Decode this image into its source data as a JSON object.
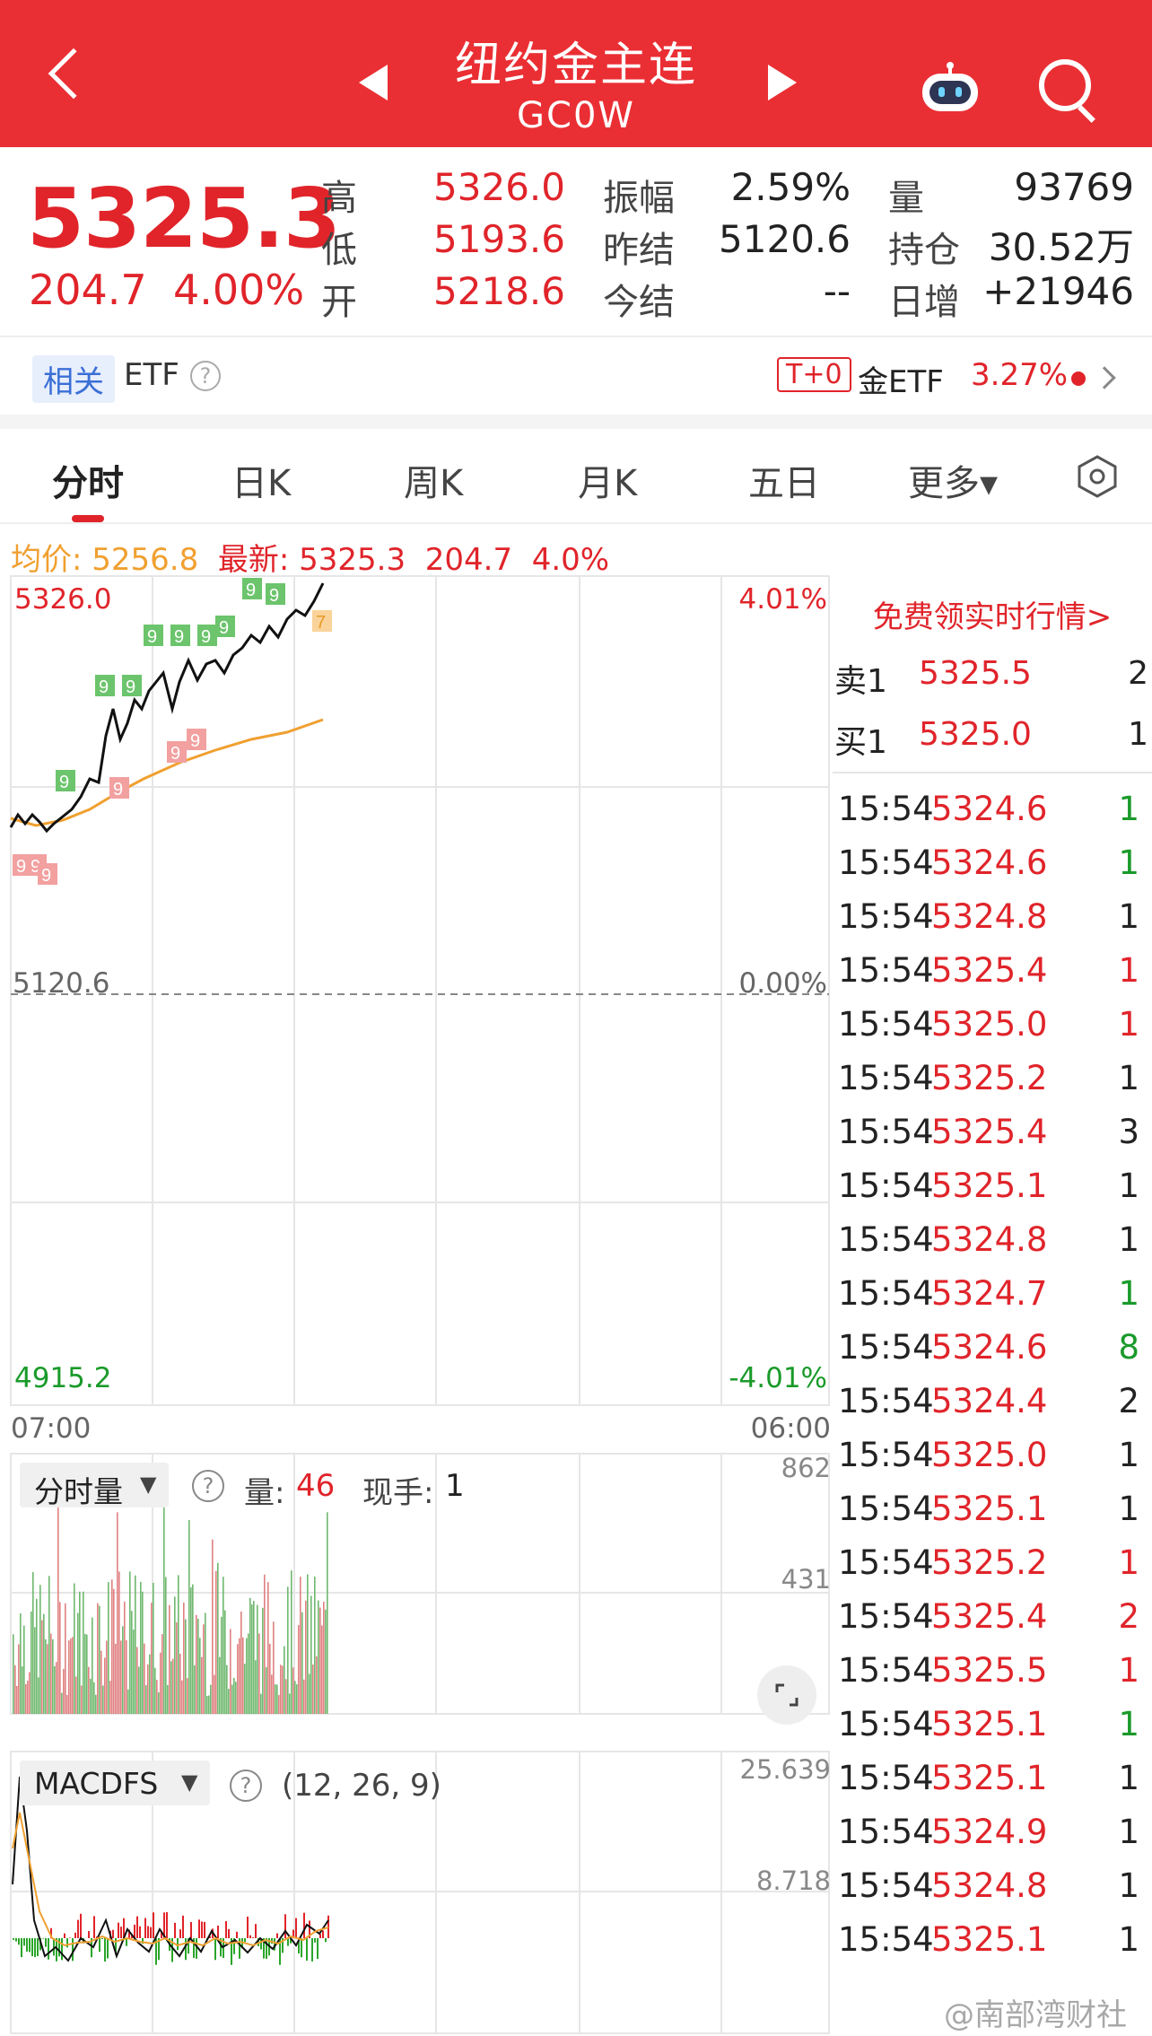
{
  "header": {
    "title": "纽约金主连",
    "code": "GC0W"
  },
  "quote": {
    "price": "5325.3",
    "change": "204.7",
    "change_pct": "4.00%",
    "fields": [
      {
        "label": "高",
        "value": "5326.0",
        "color": "red"
      },
      {
        "label": "低",
        "value": "5193.6",
        "color": "red"
      },
      {
        "label": "开",
        "value": "5218.6",
        "color": "red"
      },
      {
        "label": "振幅",
        "value": "2.59%",
        "color": "blk"
      },
      {
        "label": "昨结",
        "value": "5120.6",
        "color": "blk"
      },
      {
        "label": "今结",
        "value": "--",
        "color": "blk"
      },
      {
        "label": "量",
        "value": "93769",
        "color": "blk"
      },
      {
        "label": "持仓",
        "value": "30.52万",
        "color": "blk"
      },
      {
        "label": "日增",
        "value": "+21946",
        "color": "blk"
      }
    ]
  },
  "etf_row": {
    "tag": "相关",
    "etf": "ETF",
    "badge": "T+0",
    "name": "金ETF",
    "pct": "3.27%"
  },
  "tabs": [
    "分时",
    "日K",
    "周K",
    "月K",
    "五日",
    "更多▾"
  ],
  "info_bar": {
    "avg_label": "均价:",
    "avg_value": "5256.8",
    "latest_label": "最新:",
    "latest_value": "5325.3",
    "chg": "204.7",
    "chg_pct": "4.0%"
  },
  "price_chart": {
    "y_top": "5326.0",
    "y_mid": "5120.6",
    "y_bot": "4915.2",
    "pct_top": "4.01%",
    "pct_mid": "0.00%",
    "pct_bot": "-4.01%",
    "x_start": "07:00",
    "x_end": "06:00"
  },
  "volume_panel": {
    "selector": "分时量",
    "vol_label": "量:",
    "vol_value": "46",
    "hand_label": "现手:",
    "hand_value": "1",
    "y_top": "862",
    "y_mid": "431"
  },
  "macd_panel": {
    "selector": "MACDFS",
    "params": "(12, 26, 9)",
    "y_top": "25.639",
    "y_mid": "8.718"
  },
  "orderbook": {
    "banner": "免费领实时行情>",
    "sell": {
      "label": "卖1",
      "price": "5325.5",
      "vol": "2"
    },
    "buy": {
      "label": "买1",
      "price": "5325.0",
      "vol": "1"
    }
  },
  "ticks": [
    {
      "t": "15:54",
      "p": "5324.6",
      "v": "1",
      "c": "#1a9a2a"
    },
    {
      "t": "15:54",
      "p": "5324.6",
      "v": "1",
      "c": "#1a9a2a"
    },
    {
      "t": "15:54",
      "p": "5324.8",
      "v": "1",
      "c": "#222"
    },
    {
      "t": "15:54",
      "p": "5325.4",
      "v": "1",
      "c": "#e0242a"
    },
    {
      "t": "15:54",
      "p": "5325.0",
      "v": "1",
      "c": "#e0242a"
    },
    {
      "t": "15:54",
      "p": "5325.2",
      "v": "1",
      "c": "#222"
    },
    {
      "t": "15:54",
      "p": "5325.4",
      "v": "3",
      "c": "#222"
    },
    {
      "t": "15:54",
      "p": "5325.1",
      "v": "1",
      "c": "#222"
    },
    {
      "t": "15:54",
      "p": "5324.8",
      "v": "1",
      "c": "#222"
    },
    {
      "t": "15:54",
      "p": "5324.7",
      "v": "1",
      "c": "#1a9a2a"
    },
    {
      "t": "15:54",
      "p": "5324.6",
      "v": "8",
      "c": "#1a9a2a"
    },
    {
      "t": "15:54",
      "p": "5324.4",
      "v": "2",
      "c": "#222"
    },
    {
      "t": "15:54",
      "p": "5325.0",
      "v": "1",
      "c": "#222"
    },
    {
      "t": "15:54",
      "p": "5325.1",
      "v": "1",
      "c": "#222"
    },
    {
      "t": "15:54",
      "p": "5325.2",
      "v": "1",
      "c": "#e0242a"
    },
    {
      "t": "15:54",
      "p": "5325.4",
      "v": "2",
      "c": "#e0242a"
    },
    {
      "t": "15:54",
      "p": "5325.5",
      "v": "1",
      "c": "#e0242a"
    },
    {
      "t": "15:54",
      "p": "5325.1",
      "v": "1",
      "c": "#1a9a2a"
    },
    {
      "t": "15:54",
      "p": "5325.1",
      "v": "1",
      "c": "#222"
    },
    {
      "t": "15:54",
      "p": "5324.9",
      "v": "1",
      "c": "#222"
    },
    {
      "t": "15:54",
      "p": "5324.8",
      "v": "1",
      "c": "#222"
    },
    {
      "t": "15:54",
      "p": "5325.1",
      "v": "1",
      "c": "#222"
    }
  ],
  "watermark": "@南部湾财社",
  "colors": {
    "brand": "#ea2f34",
    "up": "#e0242a",
    "down": "#1a9a2a",
    "avg_line": "#f0a030"
  }
}
